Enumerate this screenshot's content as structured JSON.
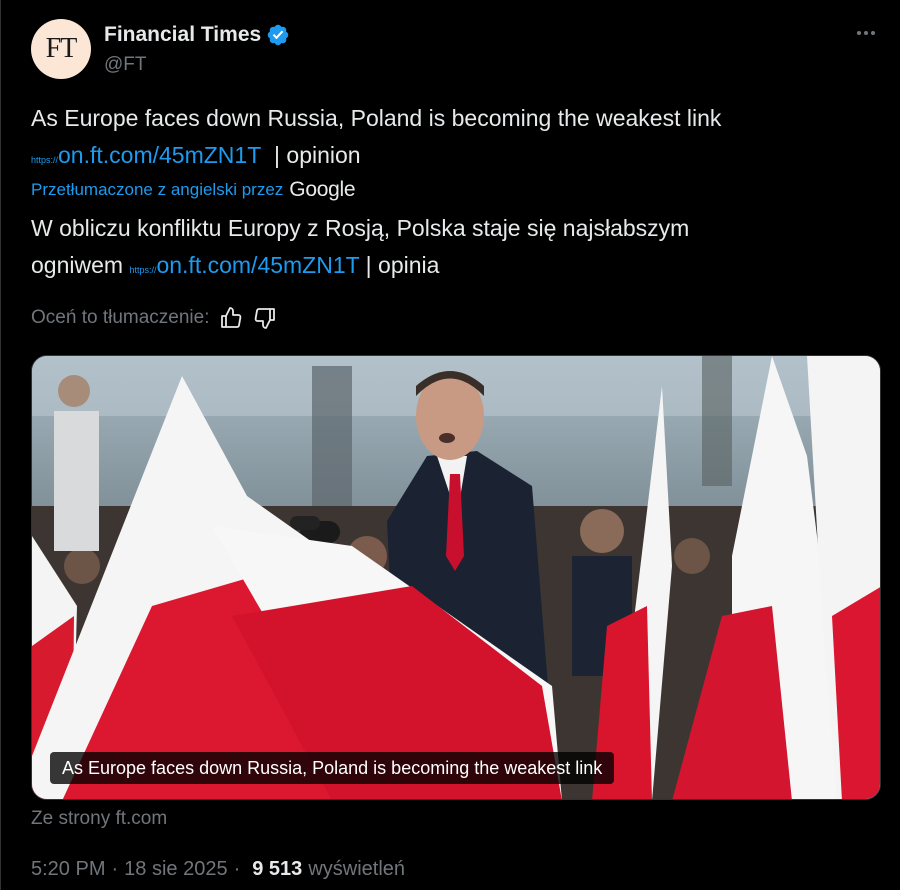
{
  "author": {
    "name": "Financial Times",
    "handle": "@FT",
    "avatar_text": "FT",
    "verified": true
  },
  "tweet": {
    "text_original": "As Europe faces down Russia, Poland is becoming the weakest link",
    "link_prefix": "https://",
    "link_text": "on.ft.com/45mZN1T",
    "suffix_original": "| opinion",
    "translated_label": "Przetłumaczone z angielski przez",
    "translated_brand": "Google",
    "text_translated": "W obliczu konfliktu Europy z Rosją, Polska staje się najsłabszym",
    "text_translated_2": "ogniwem",
    "suffix_translated": "| opinia"
  },
  "rating": {
    "label": "Oceń to tłumaczenie:",
    "icons": [
      "thumbs-up-icon",
      "thumbs-down-icon"
    ]
  },
  "card": {
    "caption": "As Europe faces down Russia, Poland is becoming the weakest link",
    "source": "Ze strony ft.com"
  },
  "meta": {
    "time": "5:20 PM",
    "date": "18 sie 2025",
    "separator": "·",
    "views": "9 513",
    "views_label": "wyświetleń"
  },
  "colors": {
    "background": "#000000",
    "text": "#e7e9ea",
    "muted": "#71767b",
    "link": "#1d9bf0",
    "avatar_bg": "#fce7d6",
    "flag_red": "#dc143c"
  }
}
